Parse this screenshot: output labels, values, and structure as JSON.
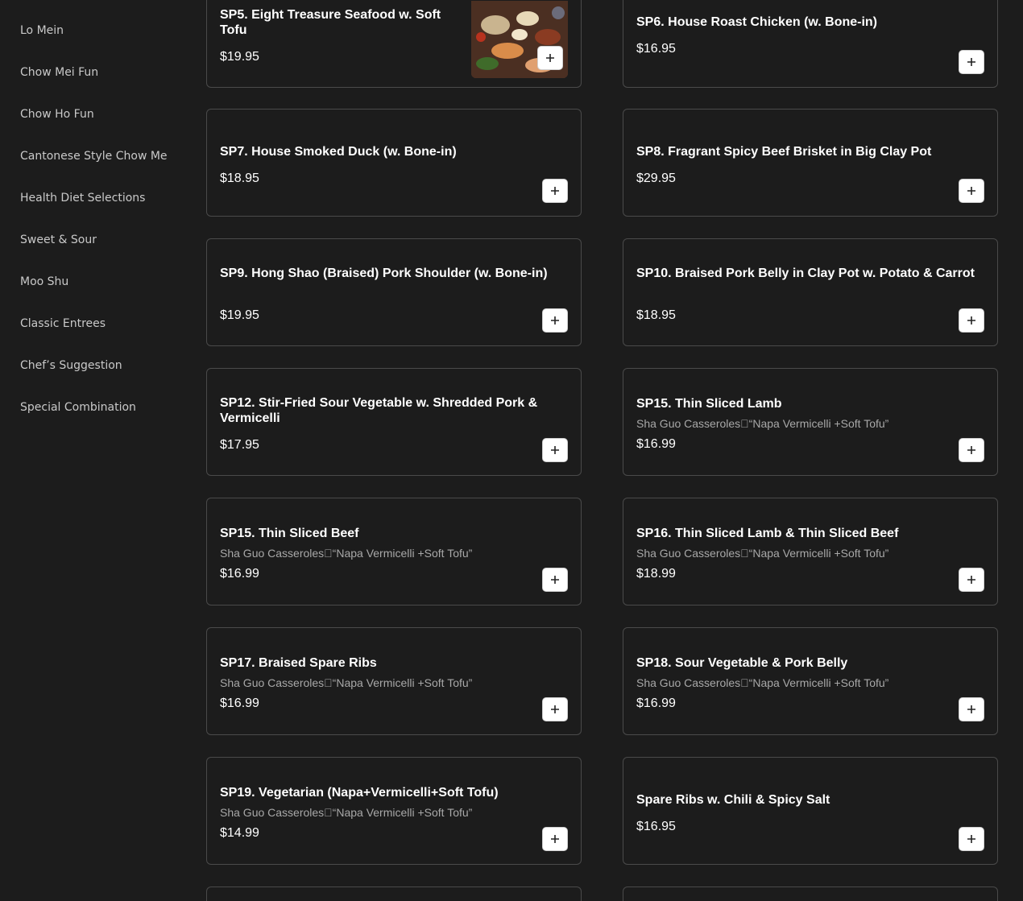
{
  "sidebar": {
    "items": [
      {
        "label": "Lo Mein"
      },
      {
        "label": "Chow Mei Fun"
      },
      {
        "label": "Chow Ho Fun"
      },
      {
        "label": "Cantonese Style Chow Me"
      },
      {
        "label": "Health Diet Selections"
      },
      {
        "label": "Sweet & Sour"
      },
      {
        "label": "Moo Shu"
      },
      {
        "label": "Classic Entrees"
      },
      {
        "label": "Chef’s Suggestion"
      },
      {
        "label": "Special Combination"
      }
    ]
  },
  "menu": {
    "items": [
      {
        "title": "SP5. Eight Treasure Seafood w. Soft Tofu",
        "desc": "",
        "price": "$19.95"
      },
      {
        "title": "SP6. House Roast Chicken (w. Bone-in)",
        "desc": "",
        "price": "$16.95"
      },
      {
        "title": "SP7. House Smoked Duck (w. Bone-in)",
        "desc": "",
        "price": "$18.95"
      },
      {
        "title": "SP8. Fragrant Spicy Beef Brisket in Big Clay Pot",
        "desc": "",
        "price": "$29.95"
      },
      {
        "title": "SP9. Hong Shao (Braised) Pork Shoulder (w. Bone-in)",
        "desc": "",
        "price": "$19.95"
      },
      {
        "title": "SP10. Braised Pork Belly in Clay Pot w. Potato & Carrot",
        "desc": "",
        "price": "$18.95"
      },
      {
        "title": "SP12. Stir-Fried Sour Vegetable w. Shredded Pork & Vermicelli",
        "desc": "",
        "price": "$17.95"
      },
      {
        "title": "SP15. Thin Sliced Lamb",
        "desc": "Sha Guo   Casseroles\u0000“Napa Vermicelli +Soft Tofu”",
        "price": "$16.99"
      },
      {
        "title": "SP15. Thin Sliced Beef",
        "desc": "Sha Guo   Casseroles\u0000“Napa Vermicelli +Soft Tofu”",
        "price": "$16.99"
      },
      {
        "title": "SP16. Thin Sliced Lamb & Thin Sliced Beef",
        "desc": "Sha Guo   Casseroles\u0000“Napa Vermicelli +Soft Tofu”",
        "price": "$18.99"
      },
      {
        "title": "SP17. Braised Spare Ribs",
        "desc": "Sha Guo   Casseroles\u0000“Napa Vermicelli +Soft Tofu”",
        "price": "$16.99"
      },
      {
        "title": "SP18. Sour Vegetable & Pork Belly",
        "desc": "Sha Guo   Casseroles\u0000“Napa Vermicelli +Soft Tofu”",
        "price": "$16.99"
      },
      {
        "title": "SP19. Vegetarian (Napa+Vermicelli+Soft Tofu)",
        "desc": "Sha Guo   Casseroles\u0000“Napa Vermicelli +Soft Tofu”",
        "price": "$14.99"
      },
      {
        "title": "Spare Ribs w. Chili & Spicy Salt",
        "desc": "",
        "price": "$16.95"
      }
    ],
    "add_icon": "plus-icon"
  },
  "colors": {
    "background": "#1c1c1c",
    "card_border": "#4a4a4a",
    "sidebar_text": "#c9c9c9",
    "desc_text": "#a8a8a8",
    "add_button_bg": "#ffffff"
  }
}
